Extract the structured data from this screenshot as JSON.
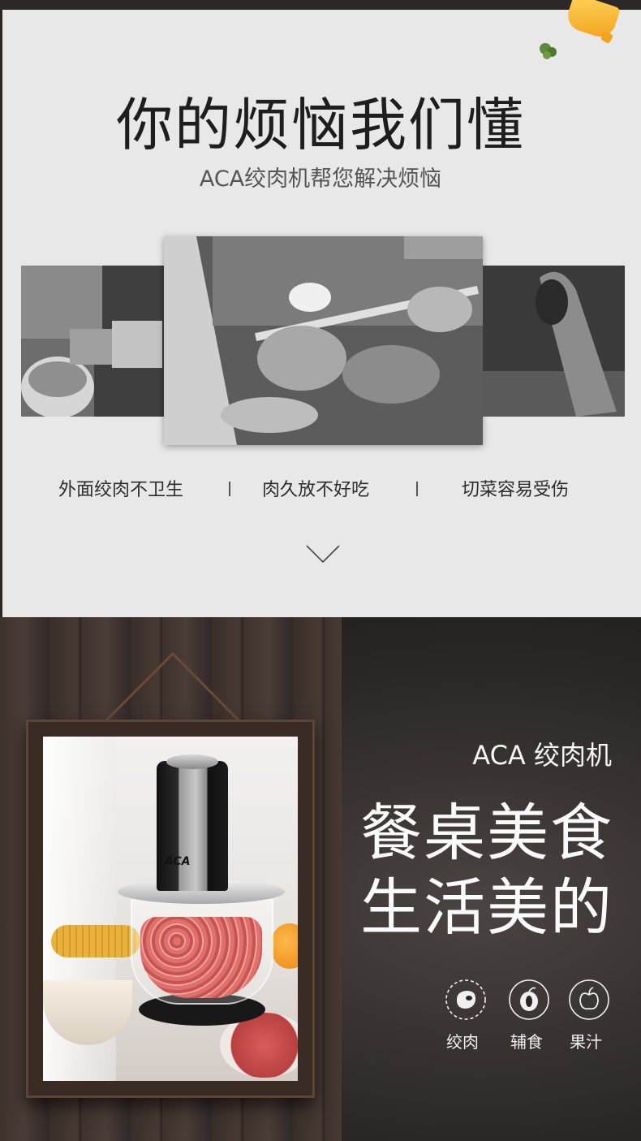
{
  "section_problems": {
    "title": "你的烦恼我们懂",
    "subtitle": "ACA绞肉机帮您解决烦恼",
    "captions": [
      "外面绞肉不卫生",
      "肉久放不好吃",
      "切菜容易受伤"
    ],
    "scroll_icon": "chevron-down-icon"
  },
  "section_product": {
    "brand_line": "ACA 绞肉机",
    "headline_1": "餐桌美食",
    "headline_2": "生活美的",
    "frame_logo": "ACA",
    "features": [
      {
        "icon": "meat-icon",
        "label": "绞肉"
      },
      {
        "icon": "fruit-icon",
        "label": "辅食"
      },
      {
        "icon": "apple-icon",
        "label": "果汁"
      }
    ]
  },
  "colors": {
    "light_bg": "#e8e8e8",
    "dark_bg": "#2a2624",
    "title_text": "#1e1e1e",
    "light_text": "#fafafa"
  }
}
